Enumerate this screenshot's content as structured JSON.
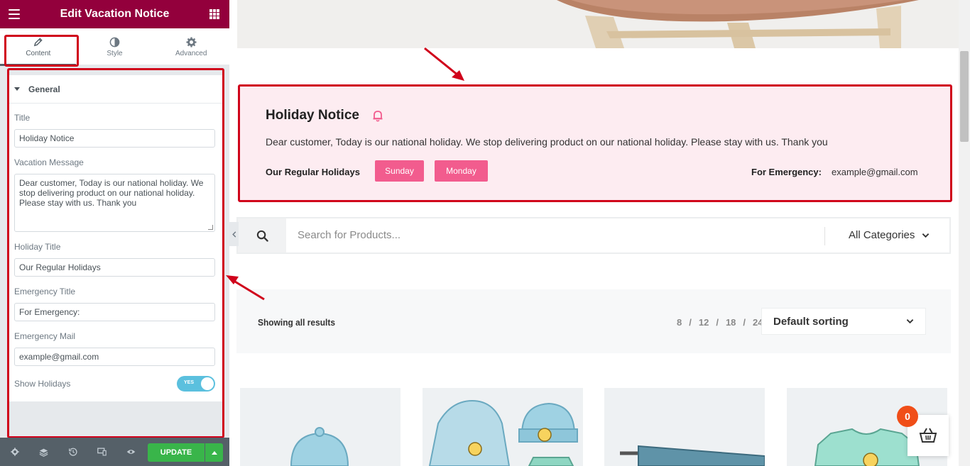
{
  "panel": {
    "header_title": "Edit Vacation Notice",
    "tabs": [
      {
        "label": "Content",
        "icon": "pencil-icon"
      },
      {
        "label": "Style",
        "icon": "half-circle-icon"
      },
      {
        "label": "Advanced",
        "icon": "gear-icon"
      }
    ],
    "section_title": "General",
    "fields": {
      "title_label": "Title",
      "title_value": "Holiday Notice",
      "message_label": "Vacation Message",
      "message_value": "Dear customer, Today is our national holiday. We stop delivering product on our national holiday. Please stay with us. Thank you",
      "holiday_title_label": "Holiday Title",
      "holiday_title_value": "Our Regular Holidays",
      "emergency_title_label": "Emergency Title",
      "emergency_title_value": "For Emergency:",
      "emergency_mail_label": "Emergency Mail",
      "emergency_mail_value": "example@gmail.com",
      "show_holidays_label": "Show Holidays",
      "show_holidays_toggle": "YES"
    },
    "footer": {
      "update_label": "UPDATE"
    }
  },
  "notice": {
    "title": "Holiday Notice",
    "message": "Dear customer, Today is our national holiday. We stop delivering product on our national holiday. Please stay with us. Thank you",
    "holidays_title": "Our Regular Holidays",
    "days": [
      "Sunday",
      "Monday"
    ],
    "emergency_title": "For Emergency:",
    "emergency_mail": "example@gmail.com"
  },
  "search": {
    "placeholder": "Search for Products...",
    "category": "All Categories"
  },
  "shop": {
    "showing": "Showing all results",
    "per_page": [
      "8",
      "/",
      "12",
      "/",
      "18",
      "/",
      "24"
    ],
    "sorting": "Default sorting"
  },
  "cart": {
    "count": "0"
  },
  "colors": {
    "panel_header": "#93003c",
    "accent_pink": "#f25c8e",
    "notice_bg": "#fdecf1",
    "annotation_red": "#d0021b",
    "update_green": "#39b54a",
    "cart_badge": "#f04e18"
  }
}
